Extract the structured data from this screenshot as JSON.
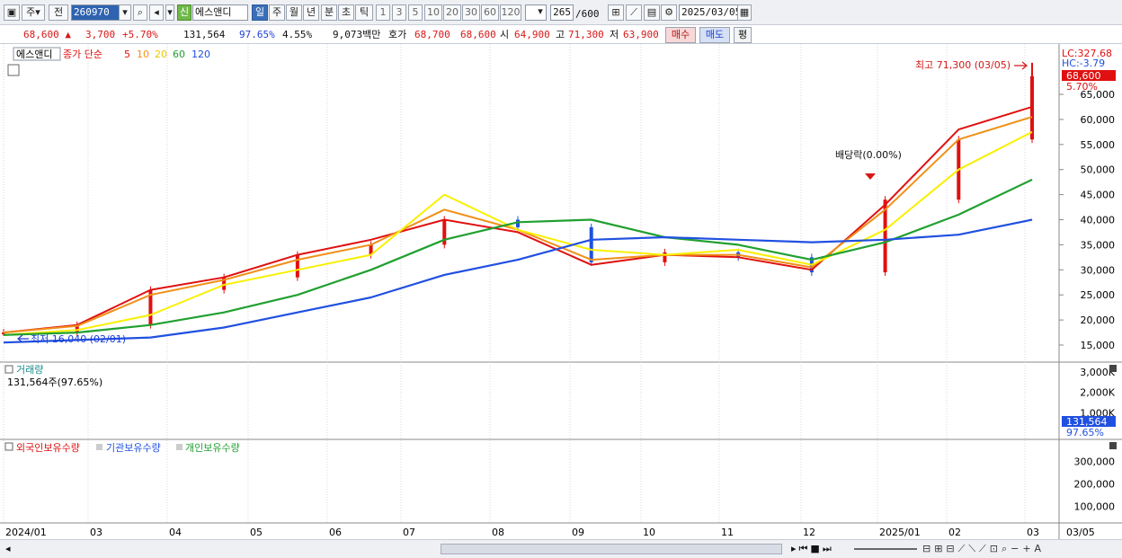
{
  "toolbar": {
    "market_type": "주",
    "prev_label": "전",
    "stock_code": "260970",
    "shin_label": "신",
    "stock_name": "에스앤디",
    "periods": [
      "일",
      "주",
      "월",
      "년",
      "분",
      "초",
      "틱"
    ],
    "selected_period": "일",
    "intervals": [
      "1",
      "3",
      "5",
      "10",
      "20",
      "30",
      "60",
      "120"
    ],
    "count_value": "265",
    "count_total": "/600",
    "date_value": "2025/03/05"
  },
  "quote": {
    "price": "68,600",
    "change": "3,700",
    "change_rate": "+5.70%",
    "volume": "131,564",
    "volume_ratio": "97.65%",
    "turnover_rate": "4.55%",
    "amount": "9,073백만",
    "bid_label": "호가",
    "ask_price": "68,700",
    "bid_price": "68,600",
    "open_label": "시",
    "open": "64,900",
    "high_label": "고",
    "high": "71,300",
    "low_label": "저",
    "low": "63,900",
    "buy_label": "매수",
    "sell_label": "매도",
    "eval_label": "평"
  },
  "price_panel": {
    "name_tag": "에스앤디",
    "ma_title": "종가 단순",
    "ma_periods": [
      "5",
      "10",
      "20",
      "60",
      "120"
    ],
    "ma_colors": [
      "#e01010",
      "#f09018",
      "#f8f000",
      "#20a030",
      "#2050e0"
    ],
    "lc_label": "LC:327.68",
    "hc_label": "HC:-3.79",
    "price_tag": "68,600",
    "rate_tag": "5.70%",
    "high_annotation": "최고 71,300 (03/05)",
    "low_annotation": "최저 16,040 (02/01)",
    "dividend_annotation": "배당락(0.00%)",
    "y_ticks": [
      "65,000",
      "60,000",
      "55,000",
      "50,000",
      "45,000",
      "40,000",
      "35,000",
      "30,000",
      "25,000",
      "20,000",
      "15,000"
    ]
  },
  "volume_panel": {
    "title": "거래량",
    "subtitle": "131,564주(97.65%)",
    "y_ticks": [
      "3,000K",
      "2,000K",
      "1,000K"
    ],
    "value_tag": "131,564",
    "rate_tag": "97.65%"
  },
  "holding_panel": {
    "legend": [
      "외국인보유수량",
      "기관보유수량",
      "개인보유수량"
    ],
    "colors": [
      "#e01010",
      "#2050e0",
      "#20a030"
    ],
    "y_ticks": [
      "300,000",
      "200,000",
      "100,000"
    ]
  },
  "x_axis": {
    "labels": [
      "2024/01",
      "03",
      "04",
      "05",
      "06",
      "07",
      "08",
      "09",
      "10",
      "11",
      "12",
      "2025/01",
      "02",
      "03"
    ],
    "end_label": "03/05"
  },
  "chart_data": {
    "type": "candlestick",
    "title": "에스앤디",
    "x": [
      "2024/01",
      "02",
      "03",
      "04",
      "05",
      "06",
      "07",
      "08",
      "09",
      "10",
      "11",
      "12",
      "2025/01",
      "02",
      "03/05"
    ],
    "close": [
      17500,
      19000,
      26000,
      28500,
      33000,
      35000,
      40000,
      38500,
      31500,
      33500,
      32500,
      29500,
      44000,
      56000,
      68600
    ],
    "ylim": [
      13000,
      69000
    ],
    "series": [
      {
        "name": "5",
        "values": [
          17500,
          19000,
          26000,
          28500,
          33000,
          36000,
          40000,
          37500,
          31000,
          33000,
          32500,
          30000,
          43000,
          58000,
          62500
        ]
      },
      {
        "name": "10",
        "values": [
          17500,
          18800,
          25000,
          28000,
          32000,
          35000,
          42000,
          38000,
          32000,
          33000,
          33000,
          30500,
          42000,
          56000,
          60500
        ]
      },
      {
        "name": "20",
        "values": [
          17000,
          18000,
          21000,
          27000,
          30000,
          33000,
          45000,
          38000,
          34000,
          33000,
          34000,
          31000,
          38000,
          50000,
          57500
        ]
      },
      {
        "name": "60",
        "values": [
          17000,
          17500,
          19000,
          21500,
          25000,
          30000,
          36000,
          39500,
          40000,
          36500,
          35000,
          32000,
          35500,
          41000,
          48000
        ]
      },
      {
        "name": "120",
        "values": [
          15500,
          16000,
          16500,
          18500,
          21500,
          24500,
          29000,
          32000,
          36000,
          36500,
          36000,
          35500,
          36000,
          37000,
          40000
        ]
      }
    ],
    "high_point": {
      "x": "03/05",
      "value": 71300
    },
    "low_point": {
      "x": "02/01",
      "value": 16040
    }
  }
}
